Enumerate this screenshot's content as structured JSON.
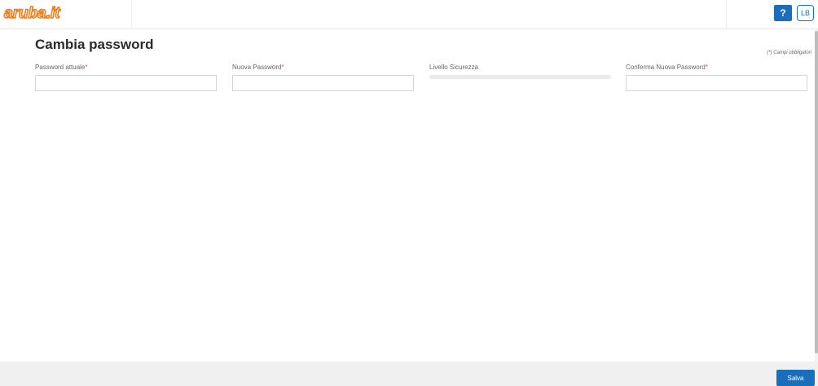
{
  "header": {
    "logo_text": "aruba.it",
    "help_label": "?",
    "user_initials": "LB"
  },
  "main": {
    "title": "Cambia password",
    "required_note": "(*) Campi obbligatori",
    "fields": [
      {
        "label": "Password attuale",
        "required_mark": "*",
        "value": ""
      },
      {
        "label": "Nuova Password",
        "required_mark": "*",
        "value": ""
      },
      {
        "label": "Livello Sicurezza",
        "level": 0
      },
      {
        "label": "Conferma Nuova Password",
        "required_mark": "*",
        "value": ""
      }
    ]
  },
  "footer": {
    "save_label": "Salva"
  },
  "colors": {
    "accent": "#1a6fbd",
    "logo": "#f07f1c",
    "required": "#d9534f"
  }
}
